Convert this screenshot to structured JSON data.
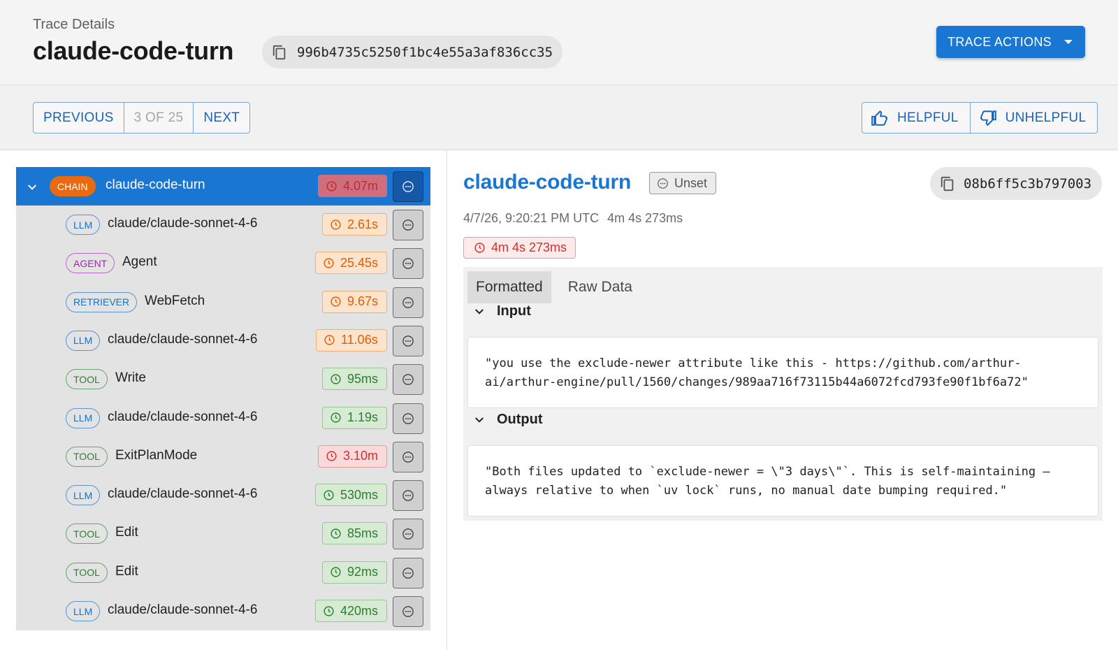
{
  "header": {
    "subtitle": "Trace Details",
    "title": "claude-code-turn",
    "trace_id": "996b4735c5250f1bc4e55a3af836cc35",
    "actions_label": "TRACE ACTIONS"
  },
  "pager": {
    "previous": "PREVIOUS",
    "count": "3 OF 25",
    "next": "NEXT"
  },
  "feedback": {
    "helpful": "HELPFUL",
    "unhelpful": "UNHELPFUL"
  },
  "tree": {
    "root": {
      "kind": "CHAIN",
      "name": "claude-code-turn",
      "duration": "4.07m",
      "status": "red"
    },
    "children": [
      {
        "kind": "LLM",
        "kind_class": "llm",
        "name": "claude/claude-sonnet-4-6",
        "duration": "2.61s",
        "status": "orange"
      },
      {
        "kind": "AGENT",
        "kind_class": "agent",
        "name": "Agent",
        "duration": "25.45s",
        "status": "orange"
      },
      {
        "kind": "RETRIEVER",
        "kind_class": "retriever",
        "name": "WebFetch",
        "duration": "9.67s",
        "status": "orange"
      },
      {
        "kind": "LLM",
        "kind_class": "llm",
        "name": "claude/claude-sonnet-4-6",
        "duration": "11.06s",
        "status": "orange"
      },
      {
        "kind": "TOOL",
        "kind_class": "tool",
        "name": "Write",
        "duration": "95ms",
        "status": "green"
      },
      {
        "kind": "LLM",
        "kind_class": "llm",
        "name": "claude/claude-sonnet-4-6",
        "duration": "1.19s",
        "status": "green"
      },
      {
        "kind": "TOOL",
        "kind_class": "tool",
        "name": "ExitPlanMode",
        "duration": "3.10m",
        "status": "red"
      },
      {
        "kind": "LLM",
        "kind_class": "llm",
        "name": "claude/claude-sonnet-4-6",
        "duration": "530ms",
        "status": "green"
      },
      {
        "kind": "TOOL",
        "kind_class": "tool",
        "name": "Edit",
        "duration": "85ms",
        "status": "green"
      },
      {
        "kind": "TOOL",
        "kind_class": "tool",
        "name": "Edit",
        "duration": "92ms",
        "status": "green"
      },
      {
        "kind": "LLM",
        "kind_class": "llm",
        "name": "claude/claude-sonnet-4-6",
        "duration": "420ms",
        "status": "green"
      }
    ]
  },
  "detail": {
    "title": "claude-code-turn",
    "status": "Unset",
    "span_id": "08b6ff5c3b797003",
    "timestamp": "4/7/26, 9:20:21 PM UTC",
    "elapsed": "4m 4s 273ms",
    "duration_badge": "4m 4s 273ms",
    "tabs": [
      "Formatted",
      "Raw Data"
    ],
    "active_tab": "Formatted",
    "input_label": "Input",
    "input_text": "\"you use the exclude-newer attribute like this - https://github.com/arthur-ai/arthur-engine/pull/1560/changes/989aa716f73115b44a6072fcd793fe90f1bf6a72\"",
    "output_label": "Output",
    "output_text": "\"Both files updated to `exclude-newer = \\\"3 days\\\"`. This is self-maintaining — always relative to when `uv lock` runs, no manual date bumping required.\""
  },
  "colors": {
    "accent": "#1976d2",
    "chain": "#ea6a12",
    "danger": "#d32f2f",
    "warning": "#e65c00",
    "success": "#2e7d32"
  }
}
